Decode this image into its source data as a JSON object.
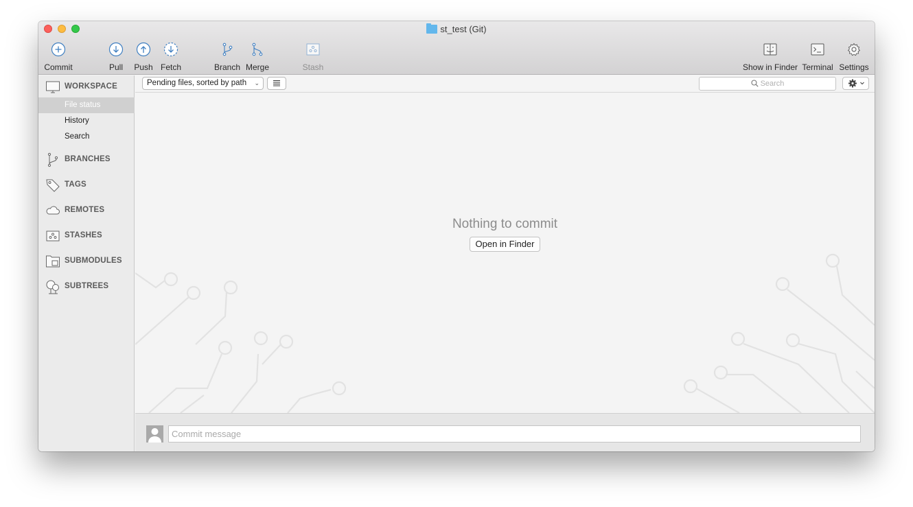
{
  "window": {
    "title": "st_test (Git)"
  },
  "toolbar": {
    "commit": "Commit",
    "pull": "Pull",
    "push": "Push",
    "fetch": "Fetch",
    "branch": "Branch",
    "merge": "Merge",
    "stash": "Stash",
    "show_in_finder": "Show in Finder",
    "terminal": "Terminal",
    "settings": "Settings"
  },
  "sidebar": {
    "workspace": "WORKSPACE",
    "items": [
      "File status",
      "History",
      "Search"
    ],
    "branches": "BRANCHES",
    "tags": "TAGS",
    "remotes": "REMOTES",
    "stashes": "STASHES",
    "submodules": "SUBMODULES",
    "subtrees": "SUBTREES"
  },
  "filterbar": {
    "sort": "Pending files, sorted by path",
    "search_placeholder": "Search"
  },
  "main": {
    "empty_title": "Nothing to commit",
    "open_finder": "Open in Finder"
  },
  "commit": {
    "placeholder": "Commit message"
  },
  "colors": {
    "icon_blue": "#3f7fc1",
    "selection": "#d0d0d0"
  }
}
